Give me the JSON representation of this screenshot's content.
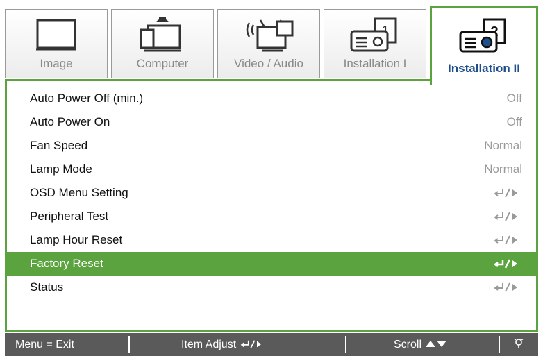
{
  "tabs": [
    {
      "label": "Image",
      "icon": "monitor-icon"
    },
    {
      "label": "Computer",
      "icon": "computer-icon"
    },
    {
      "label": "Video / Audio",
      "icon": "video-audio-icon"
    },
    {
      "label": "Installation I",
      "icon": "projector-1-icon"
    },
    {
      "label": "Installation II",
      "icon": "projector-2-icon",
      "active": true
    }
  ],
  "menu": {
    "items": [
      {
        "label": "Auto Power Off (min.)",
        "value": "Off"
      },
      {
        "label": "Auto Power On",
        "value": "Off"
      },
      {
        "label": "Fan Speed",
        "value": "Normal"
      },
      {
        "label": "Lamp Mode",
        "value": "Normal"
      },
      {
        "label": "OSD Menu Setting",
        "value": ""
      },
      {
        "label": "Peripheral Test",
        "value": ""
      },
      {
        "label": "Lamp Hour Reset",
        "value": ""
      },
      {
        "label": "Factory Reset",
        "value": "",
        "selected": true
      },
      {
        "label": "Status",
        "value": ""
      }
    ]
  },
  "footer": {
    "menu_exit": "Menu = Exit",
    "item_adjust": "Item Adjust",
    "scroll": "Scroll"
  },
  "colors": {
    "accent": "#5aa33e",
    "active_label": "#1f4f8a",
    "footer_bg": "#5a5a5a"
  }
}
